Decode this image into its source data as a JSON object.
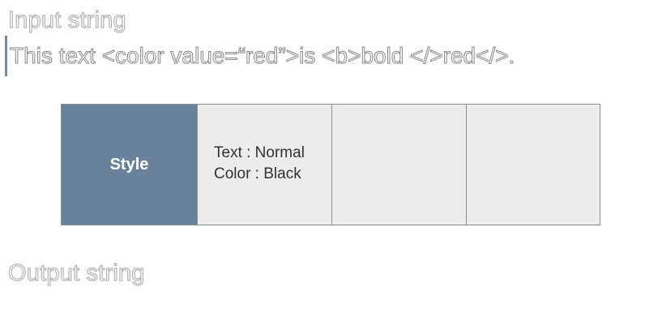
{
  "input": {
    "heading": "Input string",
    "text": "This text <color value=“red”>is <b>bold </>red</>."
  },
  "style_table": {
    "header": "Style",
    "cells": [
      {
        "line1": "Text : Normal",
        "line2": "Color : Black"
      },
      {
        "line1": "",
        "line2": ""
      },
      {
        "line1": "",
        "line2": ""
      }
    ]
  },
  "output": {
    "heading": "Output string"
  },
  "colors": {
    "header_bg": "#6a8299",
    "cell_bg": "#ececec",
    "border": "#8e8e8e",
    "heading_stroke": "#b4b4b4",
    "cursor": "#7c8a98"
  }
}
